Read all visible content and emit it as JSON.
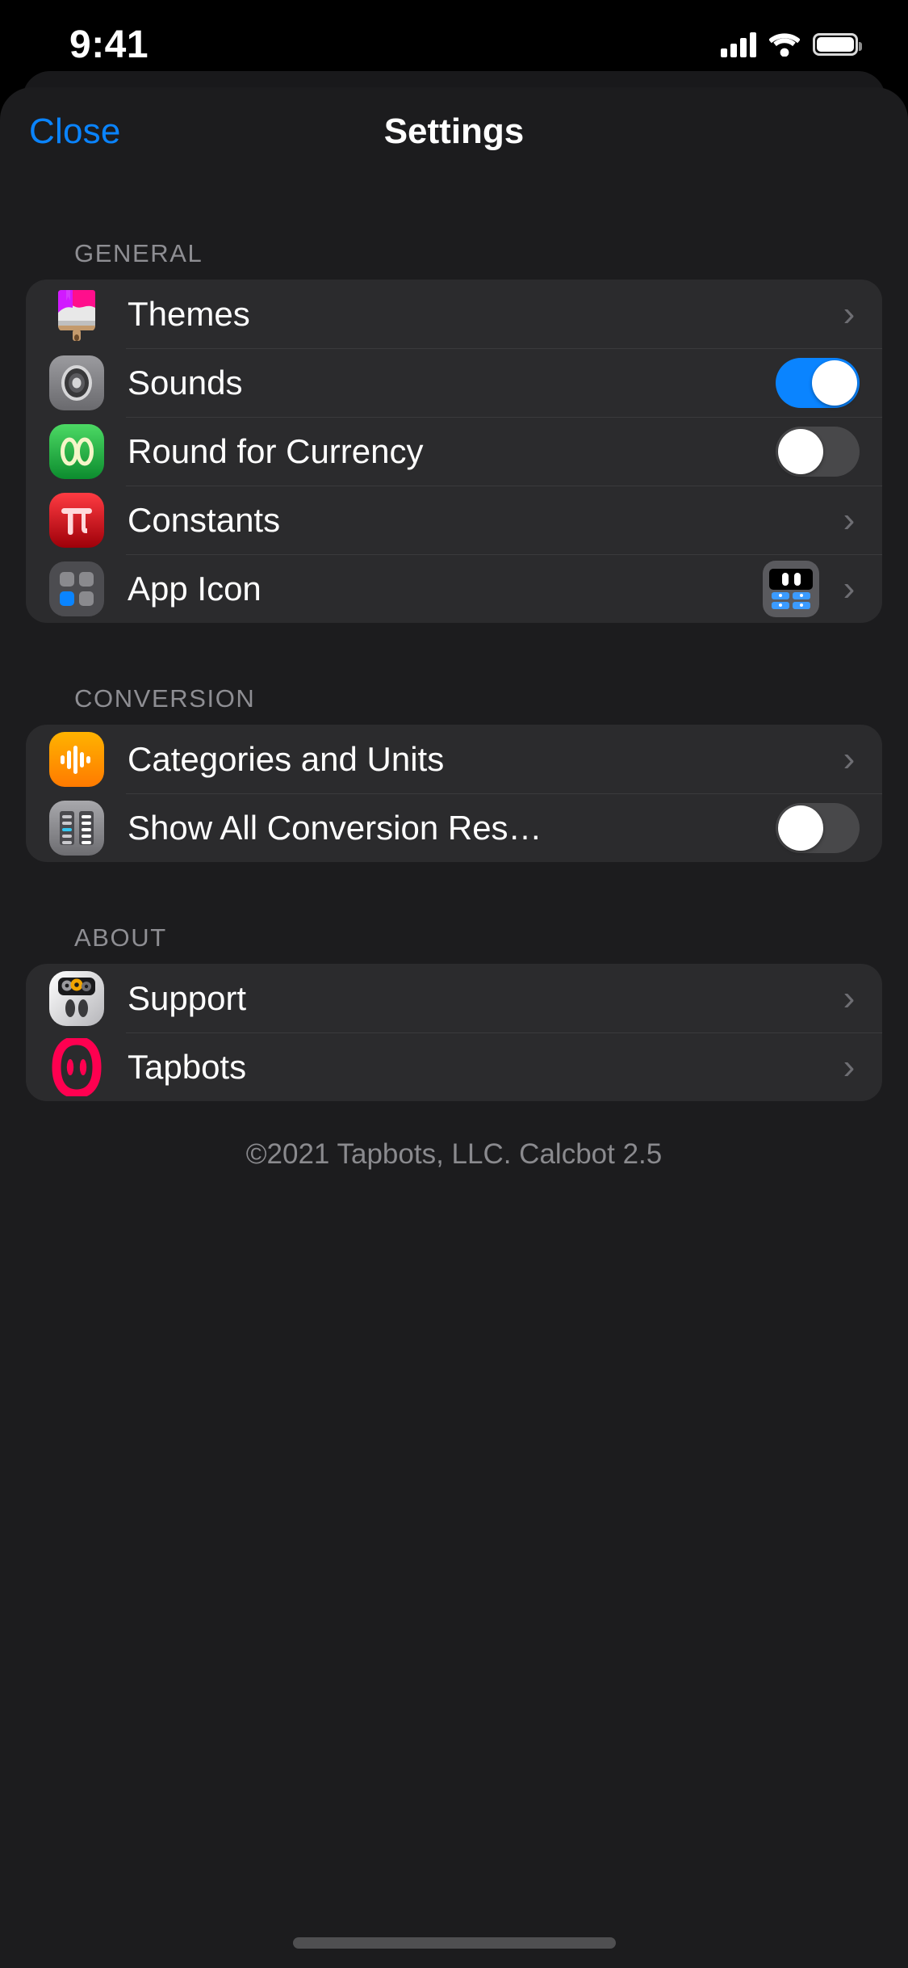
{
  "status_bar": {
    "time": "9:41",
    "signal_icon": "cellular-bars-icon",
    "wifi_icon": "wifi-icon",
    "battery_icon": "battery-full-icon"
  },
  "nav": {
    "close_label": "Close",
    "title": "Settings"
  },
  "colors": {
    "accent_blue": "#0A84FF",
    "toggle_on": "#0A84FF",
    "toggle_off": "#48484A",
    "page_bg": "#1C1C1E",
    "card_bg": "#2B2B2D",
    "separator": "#3A3A3C",
    "section_header": "#8E8E93",
    "chevron": "#6E6E73",
    "tapbots_pink": "#FF0050"
  },
  "sections": [
    {
      "header": "GENERAL",
      "rows": [
        {
          "label": "Themes",
          "icon": "paintbrush-icon",
          "accessory": "chevron",
          "chevron": "›"
        },
        {
          "label": "Sounds",
          "icon": "speaker-icon",
          "accessory": "toggle",
          "toggle_on": true
        },
        {
          "label": "Round for Currency",
          "icon": "double-zero-icon",
          "accessory": "toggle",
          "toggle_on": false
        },
        {
          "label": "Constants",
          "icon": "pi-icon",
          "accessory": "chevron",
          "chevron": "›"
        },
        {
          "label": "App Icon",
          "icon": "app-grid-icon",
          "accessory": "preview-chevron",
          "preview_icon": "calcbot-robot-icon",
          "chevron": "›"
        }
      ]
    },
    {
      "header": "CONVERSION",
      "rows": [
        {
          "label": "Categories and Units",
          "icon": "waveform-icon",
          "accessory": "chevron",
          "chevron": "›"
        },
        {
          "label": "Show All Conversion Res…",
          "icon": "unit-list-icon",
          "accessory": "toggle",
          "toggle_on": false
        }
      ]
    },
    {
      "header": "ABOUT",
      "rows": [
        {
          "label": "Support",
          "icon": "robot-gears-icon",
          "accessory": "chevron",
          "chevron": "›"
        },
        {
          "label": "Tapbots",
          "icon": "tapbots-logo-icon",
          "accessory": "chevron",
          "chevron": "›"
        }
      ]
    }
  ],
  "footer": {
    "copyright": "©2021 Tapbots, LLC. Calcbot 2.5"
  }
}
